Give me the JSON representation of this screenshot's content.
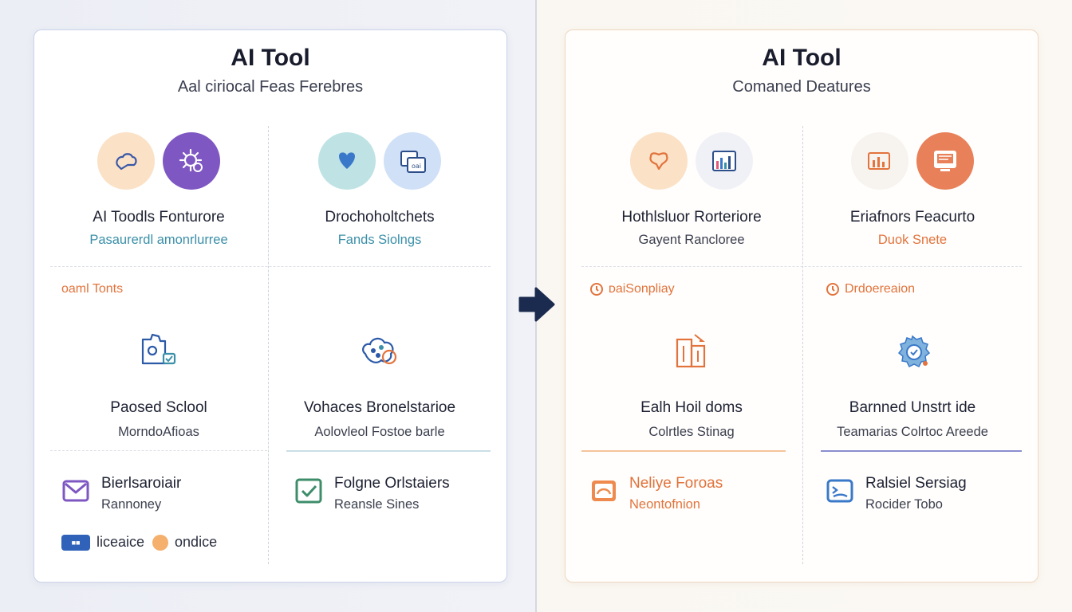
{
  "left": {
    "title": "AI Tool",
    "subtitle": "Aal ciriocal Feas Ferebres",
    "top_cells": [
      {
        "name": "AI Toodls Fonturore",
        "desc": "Pasaurerdl amonrlurree",
        "desc_color": "#3b8fa8"
      },
      {
        "name": "Drochoholtchets",
        "desc": "Fands Siolngs",
        "desc_color": "#3b8fa8"
      }
    ],
    "tag": {
      "label": "oaml Tonts",
      "color": "#e2733c"
    },
    "mid_cells": [
      {
        "name": "Paosed Sclool",
        "desc": "MorndoAfioas"
      },
      {
        "name": "Vohaces Bronelstarioe",
        "desc": "Aolovleol Fostoe barle"
      }
    ],
    "bottom_cells": [
      {
        "name": "Bierlsaroiair",
        "desc": "Rannoney",
        "icon": "mail-icon"
      },
      {
        "name": "Folgne Orlstaiers",
        "desc": "Reansle Sines",
        "icon": "check-icon"
      }
    ],
    "legend": {
      "badge_text": "■■",
      "item1": "liceaice",
      "item2": "ondice"
    }
  },
  "right": {
    "title": "AI Tool",
    "subtitle": "Comaned Deatures",
    "top_cells": [
      {
        "name": "Hothlsluor Rorteriore",
        "desc": "Gayent Rancloree",
        "desc_color": "#3b3f4e"
      },
      {
        "name": "Eriafnors Feacurto",
        "desc": "Duok Snete",
        "desc_color": "#e2733c"
      }
    ],
    "tags": [
      {
        "label": "ᴅaiSonpliay",
        "color": "#e2733c"
      },
      {
        "label": "Drdoereaion",
        "color": "#e2733c"
      }
    ],
    "mid_cells": [
      {
        "name": "Ealh Hoil doms",
        "desc": "Colrtles Stinag"
      },
      {
        "name": "Barnned Unstrt ide",
        "desc": "Teamarias Colrtoc Areede"
      }
    ],
    "bottom_cells": [
      {
        "name": "Neliye Foroas",
        "desc": "Neontofnion",
        "icon": "screen-orange-icon",
        "color": "#e2733c"
      },
      {
        "name": "Ralsiel Sersiag",
        "desc": "Rocider Tobo",
        "icon": "screen-blue-icon",
        "color": "#1e2233"
      }
    ]
  },
  "colors": {
    "accent_orange": "#e2733c",
    "accent_blue": "#2f62b8",
    "accent_purple": "#7e57c2",
    "teal": "#3b8fa8",
    "arrow": "#1b2b4f"
  }
}
